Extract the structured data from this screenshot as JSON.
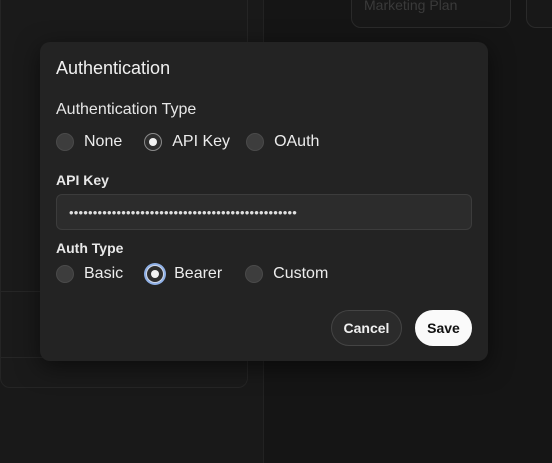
{
  "background": {
    "card_title": "Marketing Plan"
  },
  "modal": {
    "title": "Authentication",
    "auth_type": {
      "label": "Authentication Type",
      "options": [
        {
          "label": "None",
          "selected": false
        },
        {
          "label": "API Key",
          "selected": true
        },
        {
          "label": "OAuth",
          "selected": false
        }
      ]
    },
    "api_key": {
      "label": "API Key",
      "value": "••••••••••••••••••••••••••••••••••••••••••••••••"
    },
    "auth_scheme": {
      "label": "Auth Type",
      "options": [
        {
          "label": "Basic",
          "selected": false
        },
        {
          "label": "Bearer",
          "selected": true,
          "focused": true
        },
        {
          "label": "Custom",
          "selected": false
        }
      ]
    },
    "buttons": {
      "cancel_label": "Cancel",
      "save_label": "Save"
    }
  },
  "colors": {
    "modal_bg": "#232323",
    "page_bg": "#141414",
    "save_bg": "#fafafa",
    "focus_ring": "#8fb0e6"
  }
}
